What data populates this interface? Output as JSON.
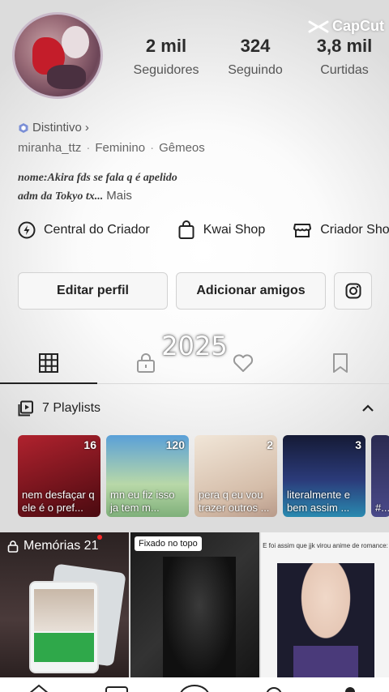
{
  "watermark": {
    "text": "CapCut"
  },
  "stats": [
    {
      "number": "2 mil",
      "label": "Seguidores"
    },
    {
      "number": "324",
      "label": "Seguindo"
    },
    {
      "number": "3,8 mil",
      "label": "Curtidas"
    }
  ],
  "profile": {
    "badge_label": "Distintivo",
    "username": "miranha_ttz",
    "gender": "Feminino",
    "sign": "Gêmeos",
    "bio_line1": "nome:Akira fds se fala q é apelido",
    "bio_line2": "adm da Tokyo tx...",
    "bio_more": "Mais"
  },
  "creator_links": [
    {
      "label": "Central do Criador",
      "icon": "lightning-icon"
    },
    {
      "label": "Kwai Shop",
      "icon": "shopping-bag-icon"
    },
    {
      "label": "Criador Sho",
      "icon": "store-icon"
    }
  ],
  "buttons": {
    "edit_profile": "Editar perfil",
    "add_friends": "Adicionar amigos"
  },
  "overlay_year": "2025",
  "tabs": [
    "grid-icon",
    "lock-icon",
    "heart-icon",
    "bookmark-icon"
  ],
  "playlists": {
    "header": "7 Playlists",
    "items": [
      {
        "count": "16",
        "title": "nem desfaçar q ele é o pref...",
        "bg": "#7a0f1a"
      },
      {
        "count": "120",
        "title": "mn eu fiz isso ja tem m...",
        "bg": "#2a6fa8"
      },
      {
        "count": "2",
        "title": "pera q eu vou trazer outros ...",
        "bg": "#d9c7b8"
      },
      {
        "count": "3",
        "title": "literalmente e bem assim ...",
        "bg": "#1c2a55"
      },
      {
        "count": "",
        "title": "#...",
        "bg": "#3a3a6a"
      }
    ]
  },
  "posts": {
    "memories_label": "Memórias 21",
    "pinned_label": "Fixado no topo",
    "anime_caption": "E foi assim que jjk virou anime de romance:"
  },
  "colors": {
    "accent": "#222222",
    "alert_dot": "#ff2a2a"
  }
}
